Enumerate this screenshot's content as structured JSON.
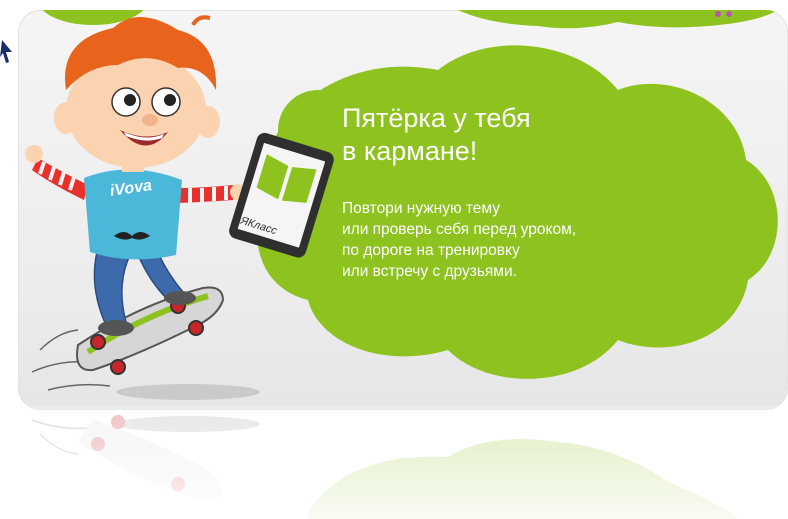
{
  "banner": {
    "headline": [
      "Пятёрка у тебя",
      "в кармане!"
    ],
    "description": [
      "Повтори нужную тему",
      "или проверь себя перед уроком,",
      "по дороге на тренировку",
      "или встречу с друзьями."
    ],
    "tablet_brand": "ЯКласс",
    "shirt_text": "iVova"
  },
  "colors": {
    "green": "#8dc21f",
    "green_dark": "#6fa816",
    "background": "#ededed",
    "hair": "#e8641c",
    "shirt": "#4bb7d9",
    "jeans": "#3d6aaa"
  },
  "icons": [
    "book-icon",
    "skateboard-illustration",
    "boy-illustration",
    "tablet-illustration"
  ]
}
